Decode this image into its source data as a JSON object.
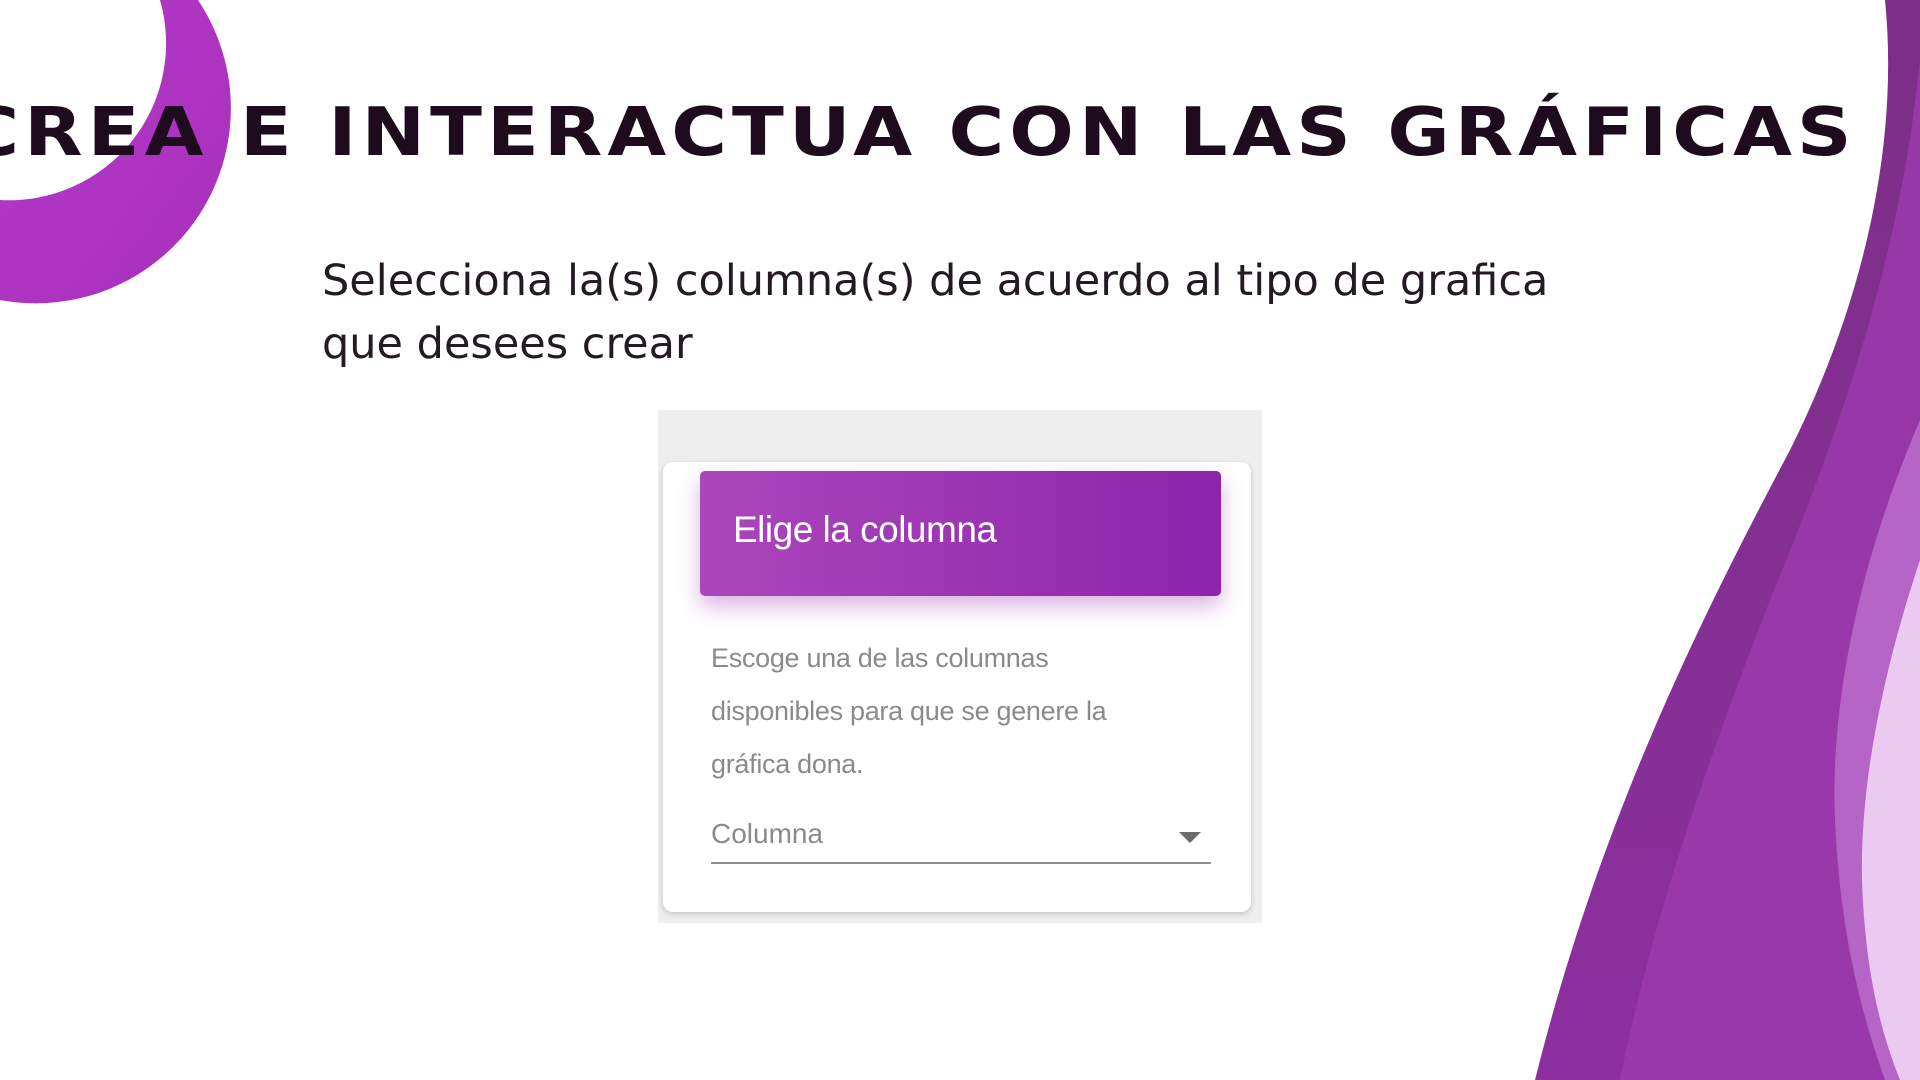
{
  "slide": {
    "title": "Crea e interactua con las gráficas",
    "instruction": "Selecciona la(s) columna(s) de acuerdo al tipo de grafica que desees crear"
  },
  "card": {
    "title": "Elige la columna",
    "description": "Escoge una de las columnas disponibles para que se genere la gráfica dona.",
    "select": {
      "label": "Columna",
      "icon": "chevron-down-icon"
    }
  },
  "colors": {
    "accent": "#8e24aa",
    "accent_light": "#ab47bc",
    "title_text": "#1e0b1e"
  }
}
